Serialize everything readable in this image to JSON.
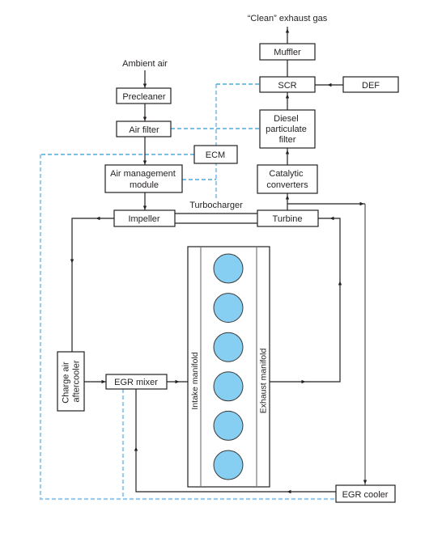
{
  "diagram": {
    "labels": {
      "clean_exhaust": "“Clean” exhaust gas",
      "ambient_air": "Ambient air",
      "turbocharger": "Turbocharger"
    },
    "components": {
      "muffler": "Muffler",
      "scr": "SCR",
      "def": "DEF",
      "dpf": [
        "Diesel",
        "particulate",
        "filter"
      ],
      "catalytic_converters": [
        "Catalytic",
        "converters"
      ],
      "turbine": "Turbine",
      "precleaner": "Precleaner",
      "air_filter": "Air filter",
      "ecm": "ECM",
      "air_management_module": [
        "Air management",
        "module"
      ],
      "impeller": "Impeller",
      "charge_air_aftercooler": [
        "Charge air",
        "aftercooler"
      ],
      "egr_mixer": "EGR mixer",
      "egr_cooler": "EGR cooler",
      "intake_manifold": "Intake manifold",
      "exhaust_manifold": "Exhaust manifold"
    },
    "engine": {
      "cylinder_count": 6
    },
    "colors": {
      "line": "#231f20",
      "control_line": "#1e9fd9",
      "control_line_light": "#9ecbe9",
      "cylinder_fill": "#86cef2"
    }
  }
}
